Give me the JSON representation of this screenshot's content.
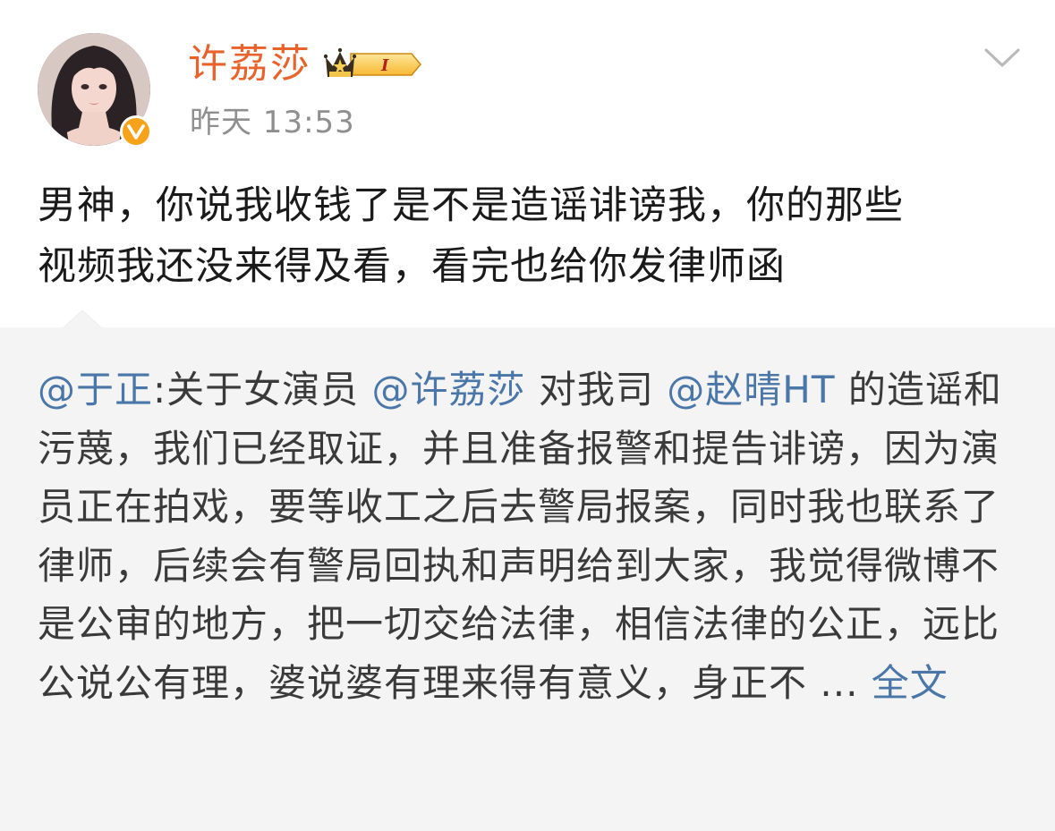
{
  "author": {
    "name": "许荔莎",
    "timestamp": "昨天 13:53",
    "vip_level": "I"
  },
  "post": {
    "text_line1": "男神，你说我收钱了是不是造谣诽谤我，你的那些",
    "text_line2": "视频我还没来得及看，看完也给你发律师函"
  },
  "repost": {
    "author_mention": "@于正",
    "sep": ":关于女演员",
    "mention_1": "@许荔莎",
    "mid_1": "对我司",
    "mention_2": "@赵晴HT",
    "body": "的造谣和污蔑，我们已经取证，并且准备报警和提告诽谤，因为演员正在拍戏，要等收工之后去警局报案，同时我也联系了律师，后续会有警局回执和声明给到大家，我觉得微博不是公审的地方，把一切交给法律，相信法律的公正，远比公说公有理，婆说婆有理来得有意义，身正不",
    "ellipsis": " ... ",
    "full_text_link": "全文"
  },
  "colors": {
    "username": "#e8632b",
    "mention": "#4a76a8",
    "repost_bg": "#f4f4f4",
    "verified_badge": "#f7a21b"
  },
  "icons": {
    "avatar": "user-avatar-photo",
    "verified": "verified-v-badge-icon",
    "vip": "crown-vip-badge-icon",
    "menu": "chevron-down-icon"
  }
}
